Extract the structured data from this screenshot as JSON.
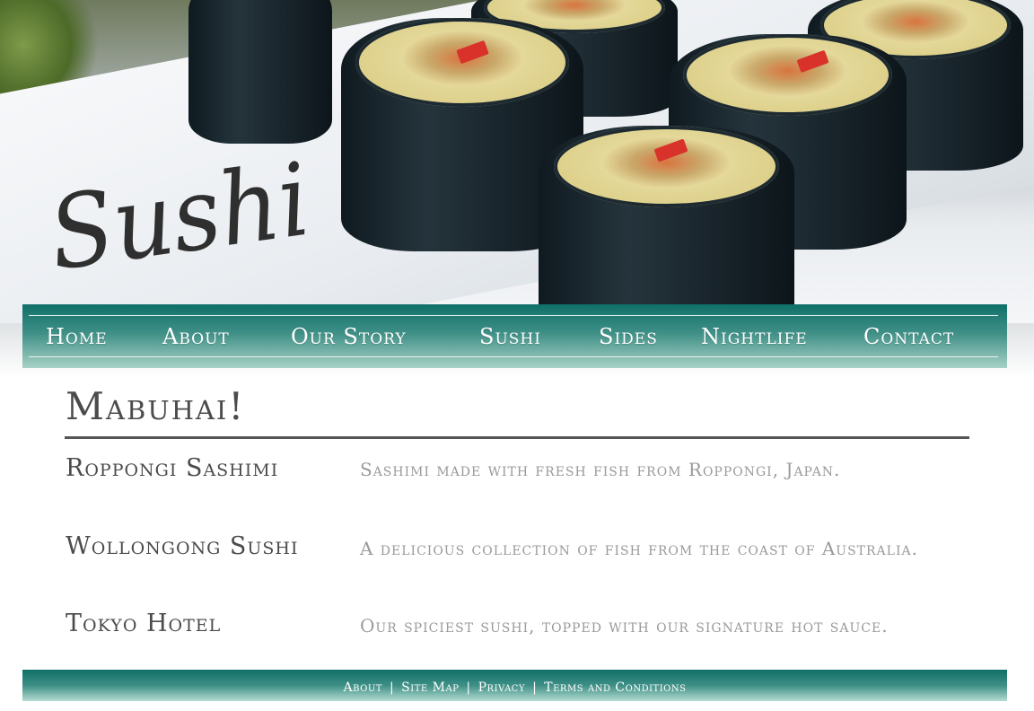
{
  "logo": {
    "text": "Sushi"
  },
  "nav": {
    "items": [
      {
        "label": "Home"
      },
      {
        "label": "About"
      },
      {
        "label": "Our Story"
      },
      {
        "label": "Sushi"
      },
      {
        "label": "Sides"
      },
      {
        "label": "Nightlife"
      },
      {
        "label": "Contact"
      }
    ]
  },
  "main": {
    "title": "Mabuhai!",
    "menu_items": [
      {
        "name": "Roppongi Sashimi",
        "description": "Sashimi made with fresh fish from Roppongi, Japan."
      },
      {
        "name": "Wollongong Sushi",
        "description": "A delicious collection of fish from the coast of Australia."
      },
      {
        "name": "Tokyo Hotel",
        "description": "Our spiciest sushi, topped with our signature hot sauce."
      }
    ]
  },
  "footer": {
    "links": [
      {
        "label": "About"
      },
      {
        "label": "Site Map"
      },
      {
        "label": "Privacy"
      },
      {
        "label": "Terms and Conditions"
      }
    ],
    "separator": "|"
  },
  "colors": {
    "nav_teal": "#0f6f68",
    "heading_gray": "#4b4b4b",
    "description_gray": "#9a9a9a"
  }
}
